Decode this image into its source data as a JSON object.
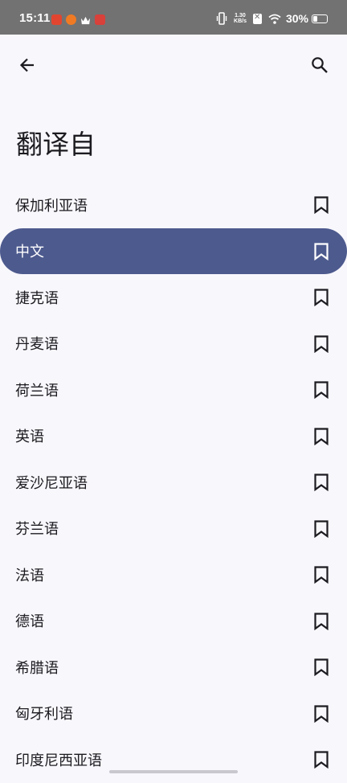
{
  "status_bar": {
    "time": "15:11",
    "net_speed_value": "1.30",
    "net_speed_unit": "KB/s",
    "battery_percent": "30%",
    "battery_level": 0.3
  },
  "app_bar": {
    "back_icon": "arrow-left-icon",
    "search_icon": "search-icon"
  },
  "page": {
    "title": "翻译自"
  },
  "languages": [
    {
      "label": "保加利亚语",
      "selected": false
    },
    {
      "label": "中文",
      "selected": true
    },
    {
      "label": "捷克语",
      "selected": false
    },
    {
      "label": "丹麦语",
      "selected": false
    },
    {
      "label": "荷兰语",
      "selected": false
    },
    {
      "label": "英语",
      "selected": false
    },
    {
      "label": "爱沙尼亚语",
      "selected": false
    },
    {
      "label": "芬兰语",
      "selected": false
    },
    {
      "label": "法语",
      "selected": false
    },
    {
      "label": "德语",
      "selected": false
    },
    {
      "label": "希腊语",
      "selected": false
    },
    {
      "label": "匈牙利语",
      "selected": false
    },
    {
      "label": "印度尼西亚语",
      "selected": false
    }
  ],
  "colors": {
    "selected_background": "#4d5a8e",
    "page_background": "#f8f7fc",
    "status_bar_background": "#727272"
  }
}
